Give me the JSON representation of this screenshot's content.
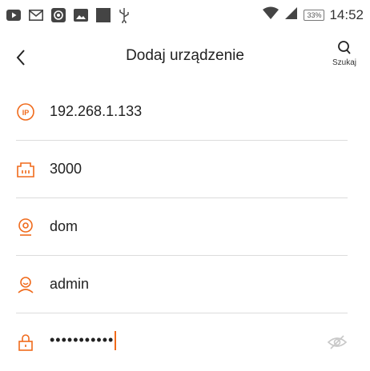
{
  "status_bar": {
    "time": "14:52",
    "battery": "33%",
    "icons": [
      "youtube-icon",
      "gmail-icon",
      "app-icon",
      "image-icon",
      "square-icon",
      "usb-icon",
      "wifi-icon",
      "signal-icon",
      "battery-icon"
    ]
  },
  "header": {
    "title": "Dodaj urządzenie",
    "search_label": "Szukaj"
  },
  "form": {
    "ip": "192.268.1.133",
    "port": "3000",
    "name": "dom",
    "username": "admin",
    "password_mask": "•••••••••••"
  },
  "colors": {
    "accent": "#f06a1b",
    "icon": "#f06a1b",
    "divider": "#dcdcdc",
    "text": "#222222"
  }
}
